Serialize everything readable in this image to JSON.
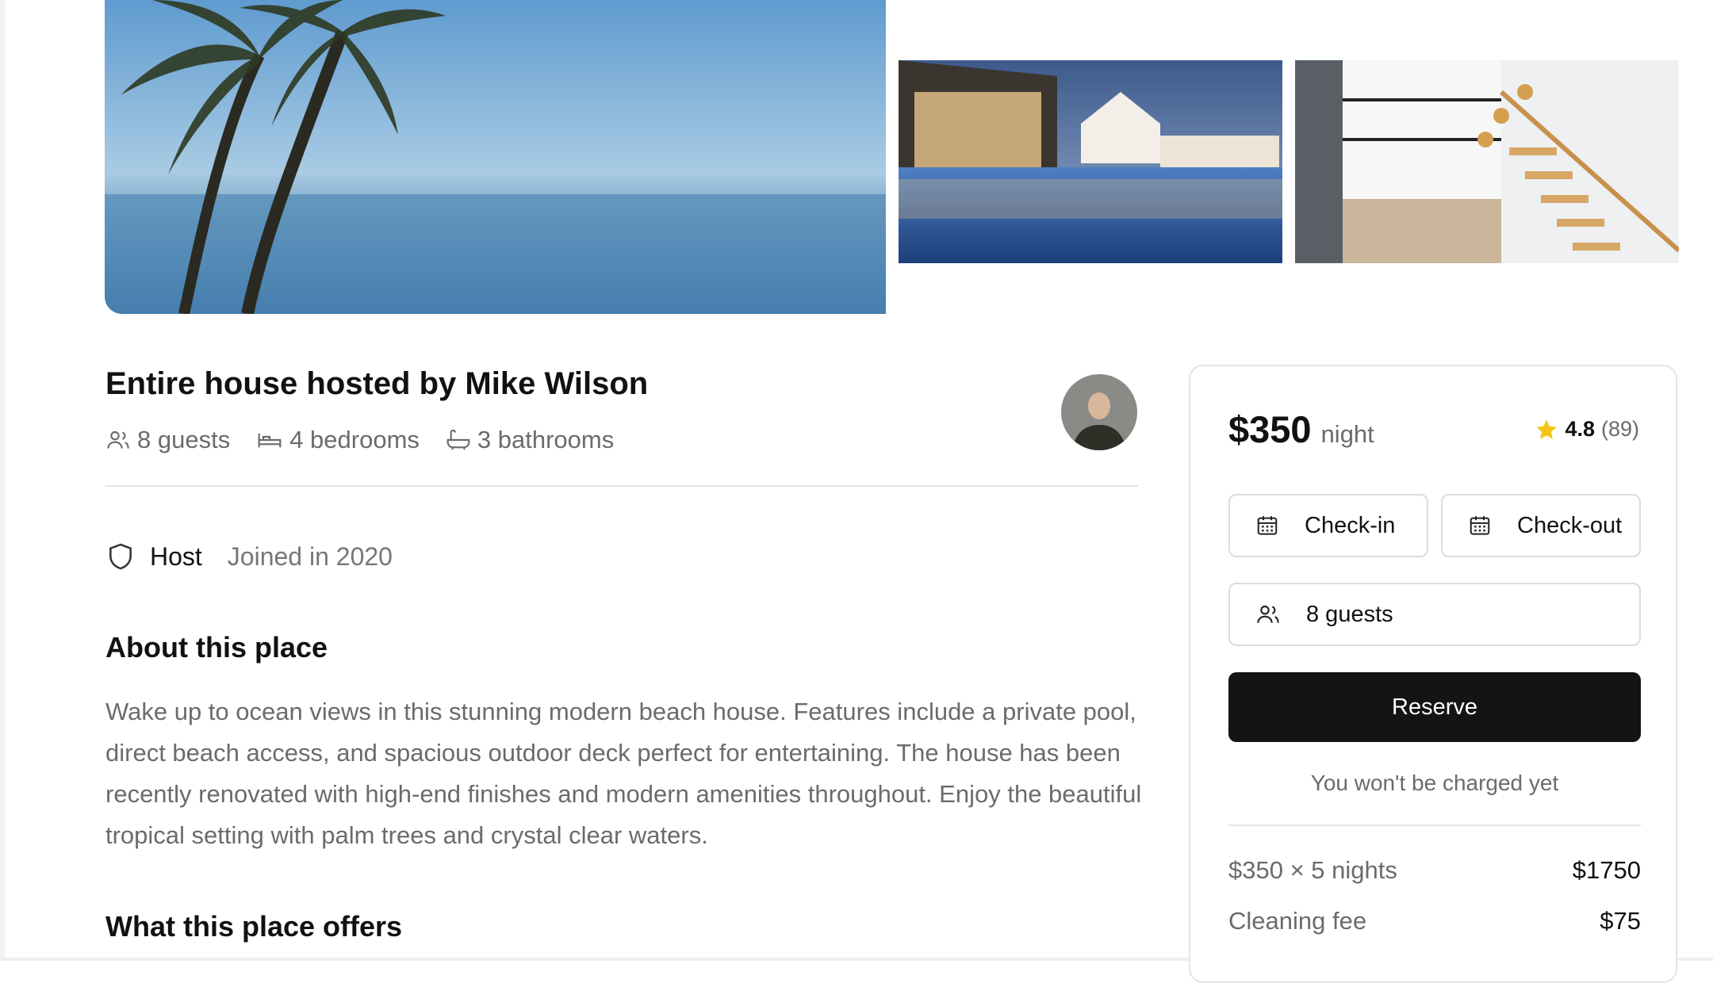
{
  "listing": {
    "title": "Entire house hosted by Mike Wilson",
    "stats": {
      "guests": "8 guests",
      "bedrooms": "4 bedrooms",
      "bathrooms": "3 bathrooms"
    }
  },
  "host": {
    "label": "Host",
    "joined": "Joined in 2020"
  },
  "about": {
    "title": "About this place",
    "text": "Wake up to ocean views in this stunning modern beach house. Features include a private pool, direct beach access, and spacious outdoor deck perfect for entertaining. The house has been recently renovated with high-end finishes and modern amenities throughout. Enjoy the beautiful tropical setting with palm trees and crystal clear waters."
  },
  "offers": {
    "title": "What this place offers"
  },
  "booking": {
    "price": "$350",
    "unit": "night",
    "rating": "4.8",
    "reviews": "(89)",
    "checkin": "Check-in",
    "checkout": "Check-out",
    "guests": "8 guests",
    "reserve": "Reserve",
    "note": "You won't be charged yet",
    "lines": [
      {
        "label": "$350 × 5 nights",
        "value": "$1750"
      },
      {
        "label": "Cleaning fee",
        "value": "$75"
      }
    ]
  },
  "colors": {
    "accent": "#141414",
    "star": "#f5c518",
    "muted_text": "#6b6b6b"
  }
}
